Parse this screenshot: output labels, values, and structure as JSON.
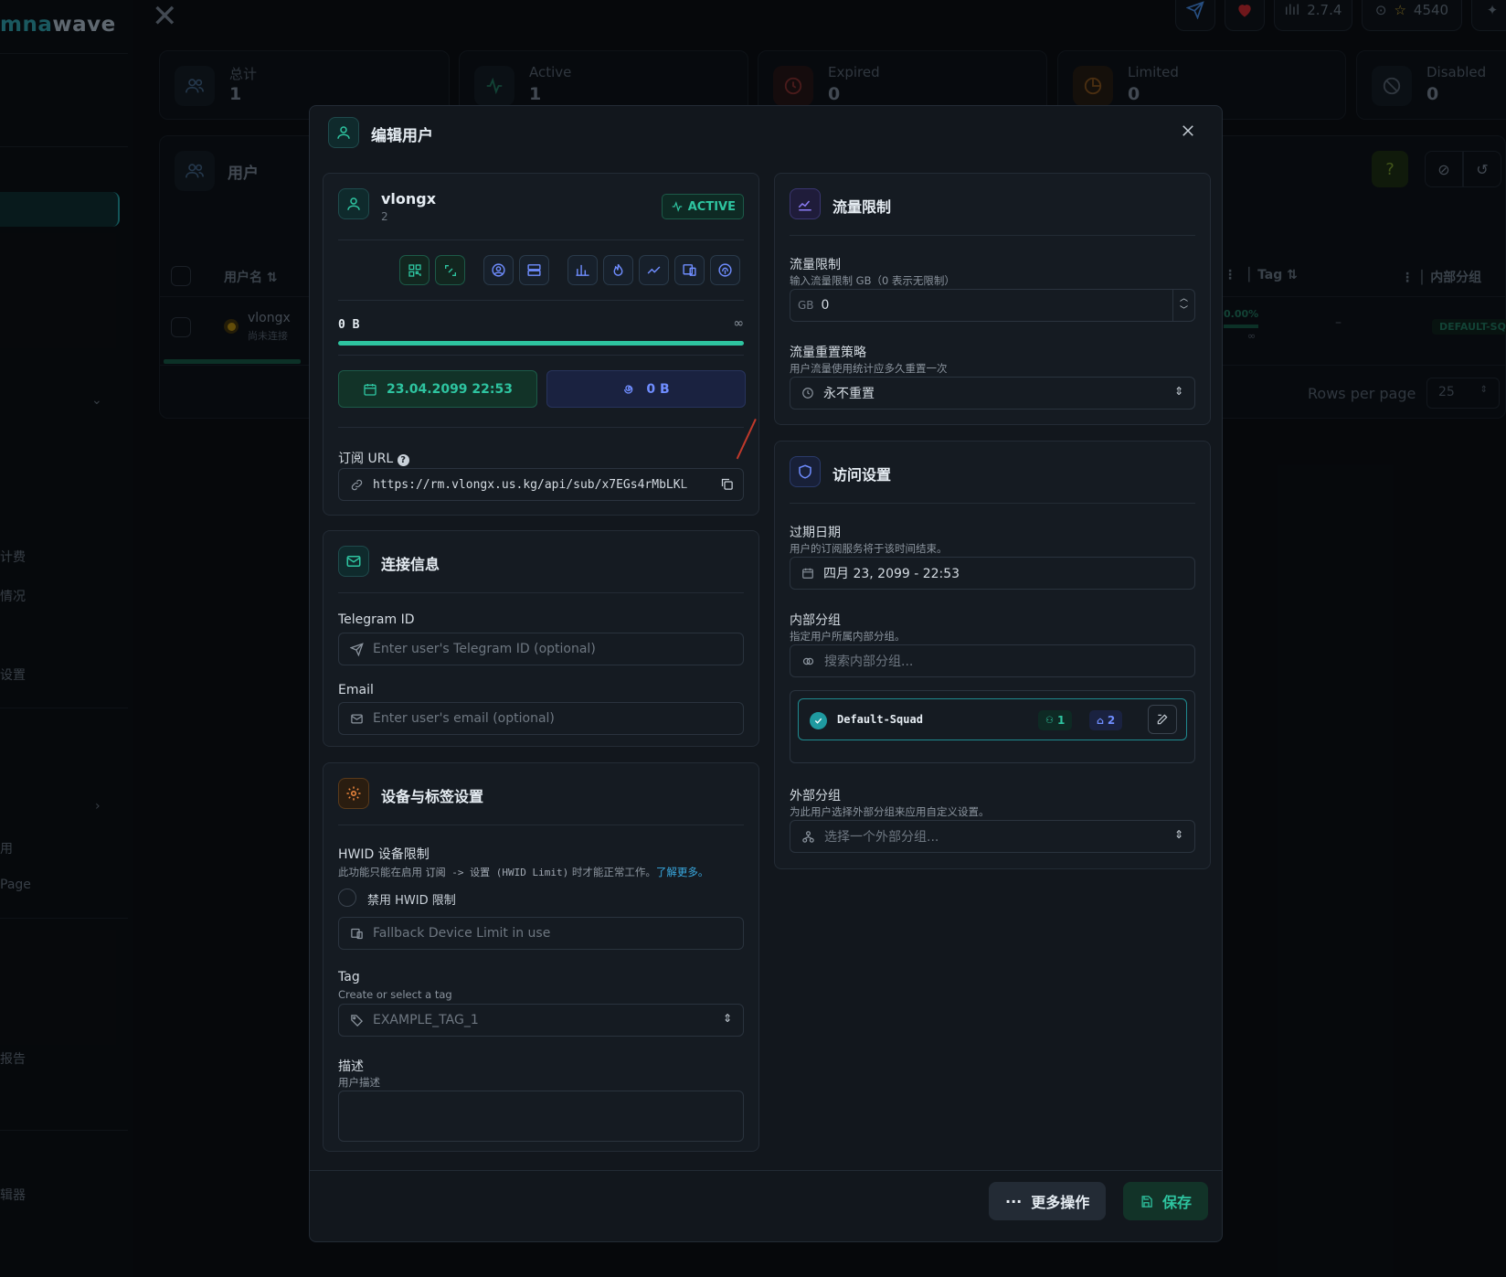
{
  "app": {
    "logo_prefix": "mna",
    "logo_suffix": "wave",
    "version": "2.7.4",
    "github_stars": "4540"
  },
  "stats": [
    {
      "label": "总计",
      "value": "1"
    },
    {
      "label": "Active",
      "value": "1"
    },
    {
      "label": "Expired",
      "value": "0"
    },
    {
      "label": "Limited",
      "value": "0"
    },
    {
      "label": "Disabled",
      "value": "0"
    }
  ],
  "sidebar": {
    "items": [
      "计费",
      "情况",
      "设置",
      "用",
      "Page",
      "报告",
      "辑器"
    ]
  },
  "users_panel": {
    "title": "用户",
    "col_username": "用户名",
    "col_tag": "Tag",
    "col_internal_group": "内部分组",
    "row_username": "vlongx",
    "row_status": "尚未连接",
    "row_percent": "0.00%",
    "row_limit": "∞",
    "row_tag": "–",
    "row_group": "DEFAULT-SQU",
    "rows_per_page_label": "Rows per page",
    "rows_per_page_value": "25"
  },
  "modal": {
    "title": "编辑用户",
    "user": {
      "name": "vlongx",
      "id": "2",
      "status": "ACTIVE",
      "used": "0 B",
      "limit": "∞",
      "usage_fraction": 1.0,
      "expire": "23.04.2099 22:53",
      "lifetime_traffic": "0 B",
      "sub_url_label": "订阅 URL",
      "sub_url": "https://rm.vlongx.us.kg/api/sub/x7EGs4rMbLKL"
    },
    "connection": {
      "title": "连接信息",
      "telegram_label": "Telegram ID",
      "telegram_placeholder": "Enter user's Telegram ID (optional)",
      "email_label": "Email",
      "email_placeholder": "Enter user's email (optional)"
    },
    "device": {
      "title": "设备与标签设置",
      "hwid_label": "HWID 设备限制",
      "hwid_desc_pre": "此功能只能在启用",
      "hwid_desc_code": "订阅 -> 设置 (HWID Limit)",
      "hwid_desc_post": "时才能正常工作。",
      "hwid_learn_more": "了解更多。",
      "hwid_disable_label": "禁用 HWID 限制",
      "hwid_placeholder": "Fallback Device Limit in use",
      "tag_label": "Tag",
      "tag_desc": "Create or select a tag",
      "tag_value": "EXAMPLE_TAG_1",
      "desc_label": "描述",
      "desc_desc": "用户描述"
    },
    "traffic": {
      "title": "流量限制",
      "limit_label": "流量限制",
      "limit_desc": "输入流量限制 GB（0 表示无限制）",
      "limit_unit": "GB",
      "limit_value": "0",
      "reset_label": "流量重置策略",
      "reset_desc": "用户流量使用统计应多久重置一次",
      "reset_value": "永不重置"
    },
    "access": {
      "title": "访问设置",
      "expire_label": "过期日期",
      "expire_desc": "用户的订阅服务将于该时间结束。",
      "expire_value": "四月 23, 2099 - 22:53",
      "internal_label": "内部分组",
      "internal_desc": "指定用户所属内部分组。",
      "internal_placeholder": "搜索内部分组...",
      "squad_name": "Default-Squad",
      "squad_users": "1",
      "squad_tags": "2",
      "external_label": "外部分组",
      "external_desc": "为此用户选择外部分组来应用自定义设置。",
      "external_placeholder": "选择一个外部分组..."
    },
    "footer": {
      "more_label": "更多操作",
      "save_label": "保存"
    }
  },
  "colors": {
    "accent": "#2ec4a0",
    "teal": "#1f8a8f",
    "blue_accent": "#5b7cf5",
    "orange": "#f0883e",
    "purple": "#8b7cf5"
  }
}
